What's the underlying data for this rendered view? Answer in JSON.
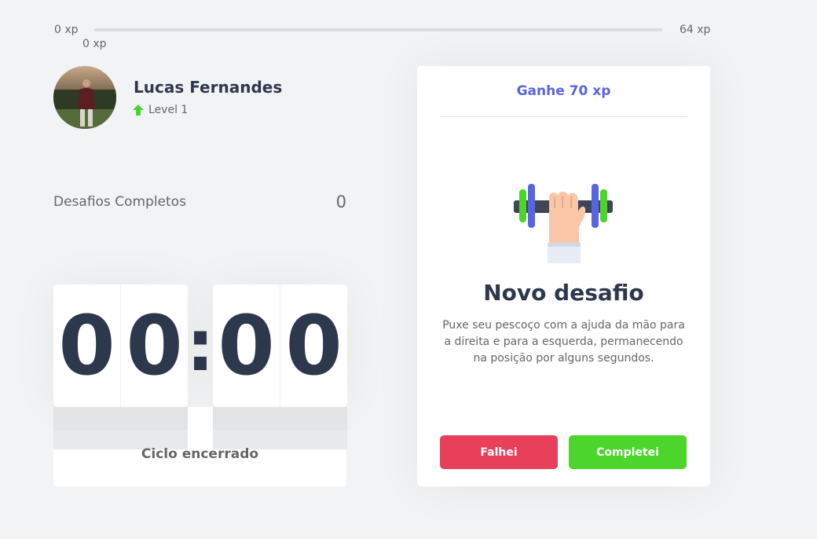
{
  "xp_bar": {
    "min_label": "0 xp",
    "max_label": "64 xp",
    "current_label": "0 xp",
    "progress_fraction": 0
  },
  "profile": {
    "name": "Lucas Fernandes",
    "level_label": "Level 1",
    "level_icon": "arrow-up-icon"
  },
  "stats": {
    "completed_label": "Desafios Completos",
    "completed_count": "0"
  },
  "countdown": {
    "minutes": [
      "0",
      "0"
    ],
    "separator": ":",
    "seconds": [
      "0",
      "0"
    ],
    "cycle_label": "Ciclo encerrado"
  },
  "challenge": {
    "reward": "Ganhe 70 xp",
    "icon": "dumbbell-hand-icon",
    "title": "Novo desafio",
    "description": "Puxe seu pescoço com a ajuda da mão para a direita e para a esquerda, permanecendo na posição por alguns segundos.",
    "fail_label": "Falhei",
    "complete_label": "Completei"
  },
  "colors": {
    "background": "#f2f3f5",
    "title": "#2e384d",
    "text": "#666666",
    "blue": "#5965e0",
    "green": "#4cd62b",
    "red": "#e83f5b"
  }
}
